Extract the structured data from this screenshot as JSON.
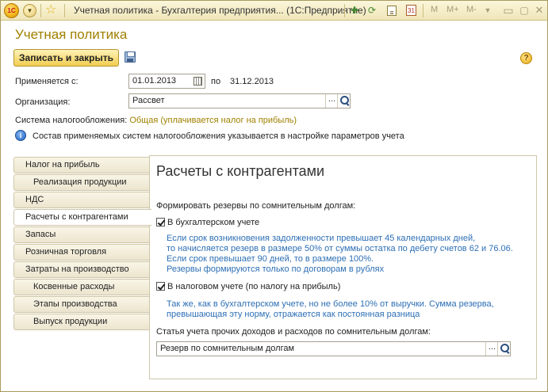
{
  "titlebar": {
    "logo_text": "1С",
    "title": "Учетная политика - Бухгалтерия предприятия... (1С:Предприятие)",
    "m": "M",
    "m_plus": "M+",
    "m_minus": "M-"
  },
  "form": {
    "title": "Учетная политика",
    "save_close_label": "Записать и закрыть",
    "help_symbol": "?"
  },
  "period": {
    "label": "Применяется с:",
    "from_value": "01.01.2013",
    "to_label": "по",
    "to_value": "31.12.2013"
  },
  "organization": {
    "label": "Организация:",
    "value": "Рассвет",
    "dots": "..."
  },
  "tax_system": {
    "label": "Система налогообложения:",
    "value": "Общая (уплачивается налог на прибыль)"
  },
  "info": {
    "symbol": "i",
    "text": "Состав применяемых систем налогообложения указывается в настройке параметров учета"
  },
  "nav": {
    "items": [
      {
        "label": "Налог на прибыль",
        "indent": false
      },
      {
        "label": "Реализация продукции",
        "indent": true
      },
      {
        "label": "НДС",
        "indent": false
      },
      {
        "label": "Расчеты с контрагентами",
        "indent": false,
        "active": true
      },
      {
        "label": "Запасы",
        "indent": false
      },
      {
        "label": "Розничная торговля",
        "indent": false
      },
      {
        "label": "Затраты на производство",
        "indent": false
      },
      {
        "label": "Косвенные расходы",
        "indent": true
      },
      {
        "label": "Этапы производства",
        "indent": true
      },
      {
        "label": "Выпуск продукции",
        "indent": true
      }
    ]
  },
  "panel": {
    "title": "Расчеты с контрагентами",
    "reserves_label": "Формировать резервы по сомнительным долгам:",
    "accounting": {
      "label": "В бухгалтерском учете",
      "checked": true,
      "note": [
        "Если срок возникновения задолженности превышает 45 календарных дней,",
        "то начисляется резерв в размере 50% от суммы остатка по дебету счетов 62 и 76.06.",
        "Если срок превышает 90 дней, то в размере 100%.",
        "Резервы формируются только по договорам в рублях"
      ]
    },
    "tax": {
      "label": "В налоговом учете (по налогу на прибыль)",
      "checked": true,
      "note": [
        "Так же, как в бухгалтерском учете, но не более 10% от выручки. Сумма резерва,",
        "превышающая эту норму, отражается как постоянная разница"
      ]
    },
    "expense_item": {
      "label": "Статья учета прочих доходов и расходов по сомнительным долгам:",
      "value": "Резерв по сомнительным долгам",
      "dots": "..."
    }
  }
}
